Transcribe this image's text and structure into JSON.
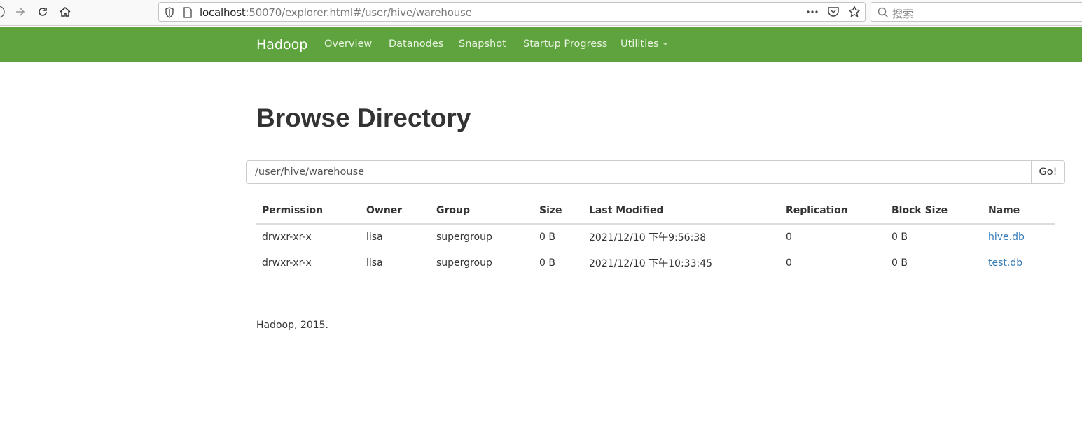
{
  "browser": {
    "url_host": "localhost",
    "url_rest": ":50070/explorer.html#/user/hive/warehouse",
    "search_placeholder": "搜索"
  },
  "navbar": {
    "brand": "Hadoop",
    "items": [
      {
        "label": "Overview"
      },
      {
        "label": "Datanodes"
      },
      {
        "label": "Snapshot"
      },
      {
        "label": "Startup Progress"
      },
      {
        "label": "Utilities"
      }
    ]
  },
  "page": {
    "title": "Browse Directory",
    "path_value": "/user/hive/warehouse",
    "go_label": "Go!"
  },
  "table": {
    "headers": [
      "Permission",
      "Owner",
      "Group",
      "Size",
      "Last Modified",
      "Replication",
      "Block Size",
      "Name"
    ],
    "rows": [
      {
        "permission": "drwxr-xr-x",
        "owner": "lisa",
        "group": "supergroup",
        "size": "0 B",
        "modified": "2021/12/10 下午9:56:38",
        "replication": "0",
        "block_size": "0 B",
        "name": "hive.db"
      },
      {
        "permission": "drwxr-xr-x",
        "owner": "lisa",
        "group": "supergroup",
        "size": "0 B",
        "modified": "2021/12/10 下午10:33:45",
        "replication": "0",
        "block_size": "0 B",
        "name": "test.db"
      }
    ]
  },
  "footer": {
    "text": "Hadoop, 2015."
  },
  "colors": {
    "navbar": "#5fa33e",
    "link": "#337ab7"
  }
}
